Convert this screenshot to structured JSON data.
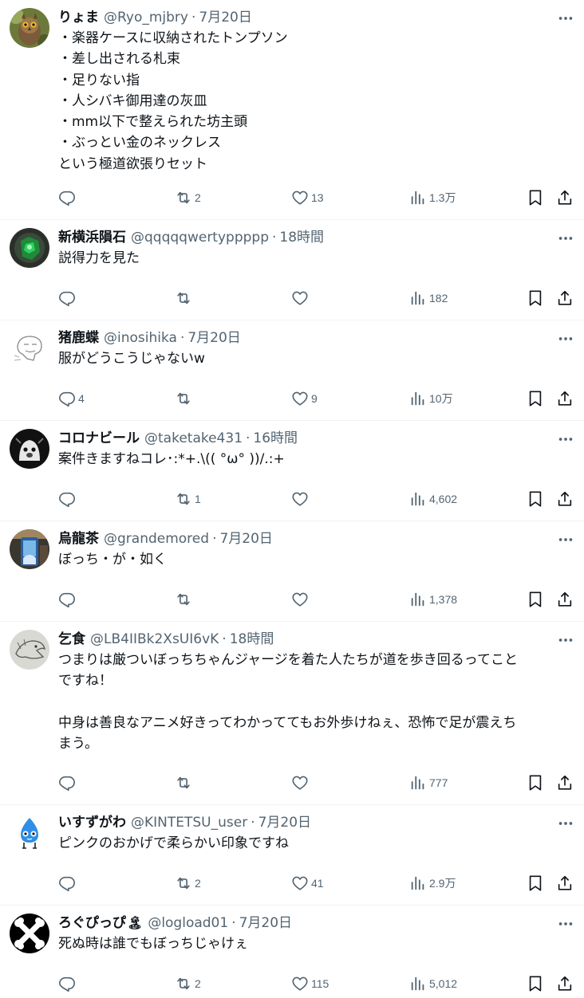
{
  "tweets": [
    {
      "name": "りょま",
      "handle": "@Ryo_mjbry",
      "time": "7月20日",
      "lines": [
        "・楽器ケースに収納されたトンプソン",
        "・差し出される札束",
        "・足りない指",
        "・人シバキ御用達の灰皿",
        "・mm以下で整えられた坊主頭",
        "・ぶっとい金のネックレス",
        "という極道欲張りセット"
      ],
      "replies": "",
      "retweets": "2",
      "likes": "13",
      "views": "1.3万"
    },
    {
      "name": "新横浜隕石",
      "handle": "@qqqqqwertyppppp",
      "time": "18時間",
      "lines": [
        "説得力を見た"
      ],
      "replies": "",
      "retweets": "",
      "likes": "",
      "views": "182"
    },
    {
      "name": "猪鹿蝶",
      "handle": "@inosihika",
      "time": "7月20日",
      "lines": [
        "服がどうこうじゃないw"
      ],
      "replies": "4",
      "retweets": "",
      "likes": "9",
      "views": "10万"
    },
    {
      "name": "コロナビール",
      "handle": "@taketake431",
      "time": "16時間",
      "lines": [
        "案件きますねコレ･:*+.\\(( °ω° ))/.:+"
      ],
      "replies": "",
      "retweets": "1",
      "likes": "",
      "views": "4,602"
    },
    {
      "name": "烏龍茶",
      "handle": "@grandemored",
      "time": "7月20日",
      "lines": [
        "ぼっち・が・如く"
      ],
      "replies": "",
      "retweets": "",
      "likes": "",
      "views": "1,378"
    },
    {
      "name": "乞食",
      "handle": "@LB4IIBk2XsUI6vK",
      "time": "18時間",
      "lines": [
        "つまりは厳ついぼっちちゃんジャージを着た人たちが道を歩き回るってこと",
        "ですね！",
        "",
        "中身は善良なアニメ好きってわかっててもお外歩けねぇ、恐怖で足が震えち",
        "まう。"
      ],
      "replies": "",
      "retweets": "",
      "likes": "",
      "views": "777"
    },
    {
      "name": "いすずがわ",
      "handle": "@KINTETSU_user",
      "time": "7月20日",
      "lines": [
        "ピンクのおかげで柔らかい印象ですね"
      ],
      "replies": "",
      "retweets": "2",
      "likes": "41",
      "views": "2.9万"
    },
    {
      "name": "ろぐぴっぴ",
      "name_emoji": "🏝",
      "handle": "@logload01",
      "time": "7月20日",
      "lines": [
        "死ぬ時は誰でもぼっちじゃけぇ"
      ],
      "replies": "",
      "retweets": "2",
      "likes": "115",
      "views": "5,012"
    }
  ],
  "colors": {
    "text": "#0f1419",
    "secondary": "#536471",
    "divider": "#eff3f4"
  },
  "icons": [
    "reply-icon",
    "retweet-icon",
    "like-icon",
    "views-icon",
    "bookmark-icon",
    "share-icon",
    "more-icon"
  ]
}
